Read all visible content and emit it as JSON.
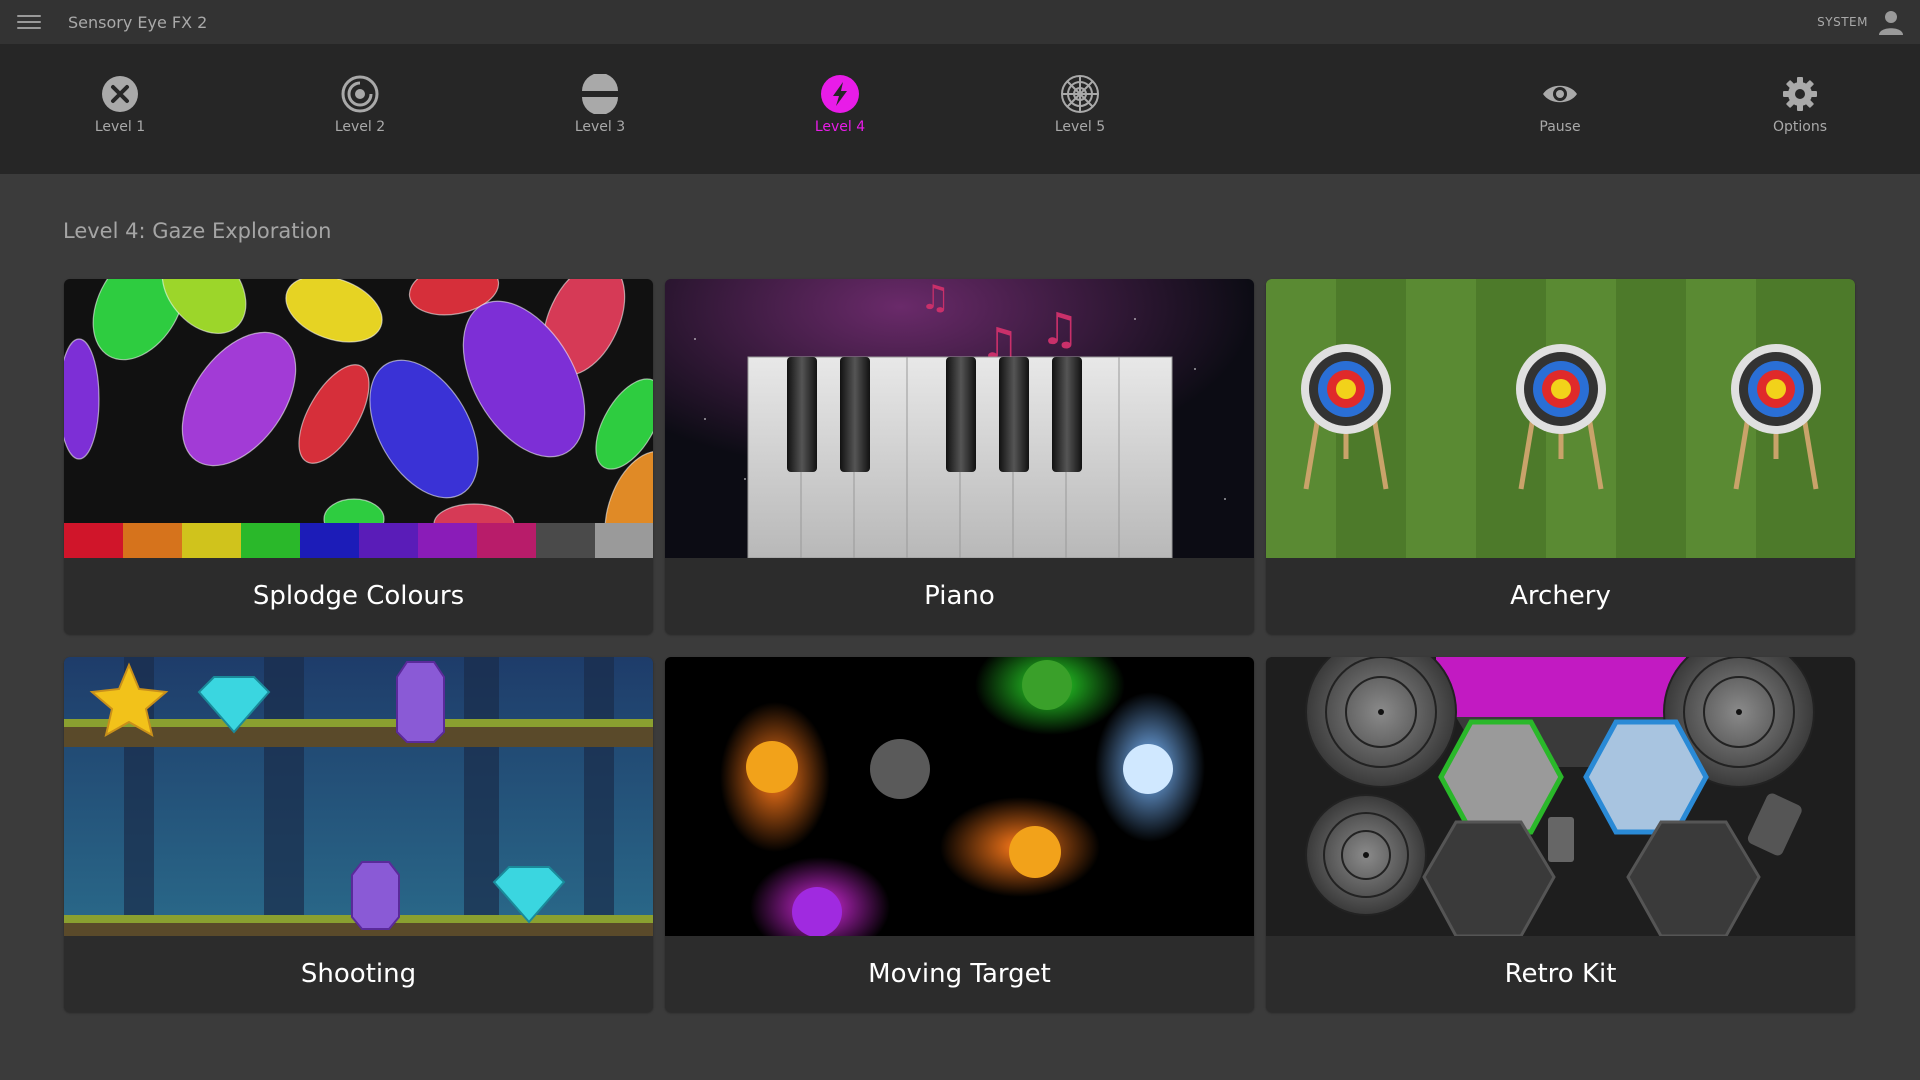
{
  "app": {
    "title": "Sensory Eye FX 2",
    "user_label": "SYSTEM"
  },
  "nav": {
    "items": [
      {
        "label": "Level 1",
        "icon": "x-circle-icon"
      },
      {
        "label": "Level 2",
        "icon": "swirl-icon"
      },
      {
        "label": "Level 3",
        "icon": "split-circle-icon"
      },
      {
        "label": "Level 4",
        "icon": "lightning-icon",
        "active": true
      },
      {
        "label": "Level 5",
        "icon": "web-icon"
      },
      {
        "label": "Pause",
        "icon": "eye-icon"
      },
      {
        "label": "Options",
        "icon": "gear-icon"
      }
    ],
    "active_color": "#e81ce8"
  },
  "section": {
    "title": "Level 4: Gaze Exploration"
  },
  "activities": [
    {
      "label": "Splodge Colours"
    },
    {
      "label": "Piano"
    },
    {
      "label": "Archery"
    },
    {
      "label": "Shooting"
    },
    {
      "label": "Moving Target"
    },
    {
      "label": "Retro Kit"
    }
  ]
}
